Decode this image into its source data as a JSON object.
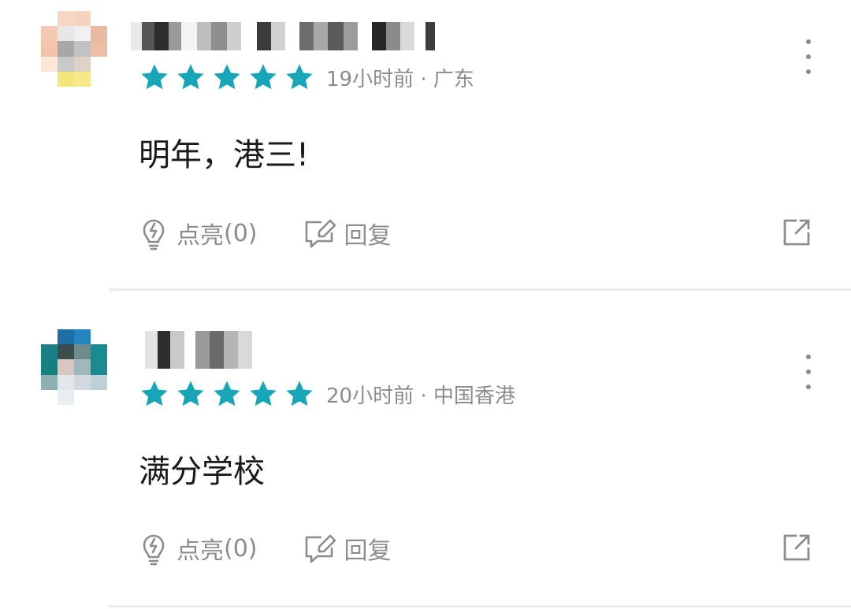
{
  "comments": [
    {
      "rating": 5,
      "time": "19小时前",
      "location": "广东",
      "separator": "·",
      "text": "明年，港三!",
      "like_label": "点亮",
      "like_count": "(0)",
      "reply_label": "回复"
    },
    {
      "rating": 5,
      "time": "20小时前",
      "location": "中国香港",
      "separator": "·",
      "text": "满分学校",
      "like_label": "点亮",
      "like_count": "(0)",
      "reply_label": "回复"
    }
  ],
  "colors": {
    "star": "#17a5b8",
    "meta_text": "#8c8c8c",
    "action_icon": "#8c8c8c",
    "divider": "#ececec"
  },
  "icons": {
    "more": "more-vertical-icon",
    "like": "lightbulb-icon",
    "reply": "edit-reply-icon",
    "share": "share-external-icon",
    "star": "star-icon"
  }
}
